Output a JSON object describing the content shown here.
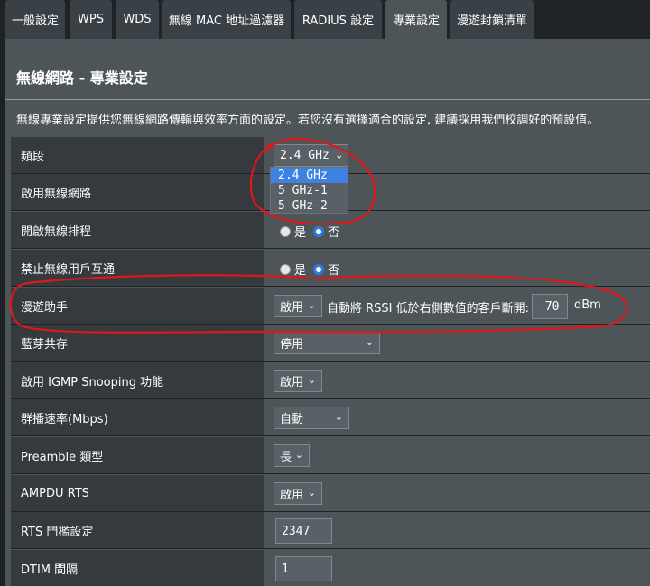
{
  "tabs": [
    {
      "label": "一般設定",
      "active": false
    },
    {
      "label": "WPS",
      "active": false
    },
    {
      "label": "WDS",
      "active": false
    },
    {
      "label": "無線 MAC 地址過濾器",
      "active": false
    },
    {
      "label": "RADIUS 設定",
      "active": false
    },
    {
      "label": "專業設定",
      "active": true
    },
    {
      "label": "漫遊封鎖清單",
      "active": false
    }
  ],
  "page": {
    "title": "無線網路 - 專業設定",
    "description": "無線專業設定提供您無線網路傳輸與效率方面的設定。若您沒有選擇適合的設定, 建議採用我們校調好的預設值。"
  },
  "band": {
    "label": "頻段",
    "value": "2.4 GHz",
    "options": [
      "2.4 GHz",
      "5 GHz-1",
      "5 GHz-2"
    ]
  },
  "enable_radio": {
    "label": "啟用無線網路"
  },
  "radio_schedule": {
    "label": "開啟無線排程",
    "yes": "是",
    "no": "否",
    "selected": "no"
  },
  "ap_isolation": {
    "label": "禁止無線用戶互通",
    "yes": "是",
    "no": "否",
    "selected": "no"
  },
  "roaming": {
    "label": "漫遊助手",
    "value": "啟用",
    "description": "自動將 RSSI 低於右側數值的客戶斷開:",
    "rssi": "-70",
    "unit": "dBm"
  },
  "bluetooth": {
    "label": "藍芽共存",
    "value": "停用"
  },
  "igmp": {
    "label": "啟用 IGMP Snooping 功能",
    "value": "啟用"
  },
  "multicast": {
    "label": "群播速率(Mbps)",
    "value": "自動"
  },
  "preamble": {
    "label": "Preamble 類型",
    "value": "長"
  },
  "ampdu": {
    "label": "AMPDU RTS",
    "value": "啟用"
  },
  "rts": {
    "label": "RTS 門檻設定",
    "value": "2347"
  },
  "dtim": {
    "label": "DTIM 間隔",
    "value": "1"
  },
  "chevron": "⌄",
  "colors": {
    "annotation": "#e0161b",
    "selected_option": "#3d82e0",
    "radio_checked": "#2a7de1"
  }
}
